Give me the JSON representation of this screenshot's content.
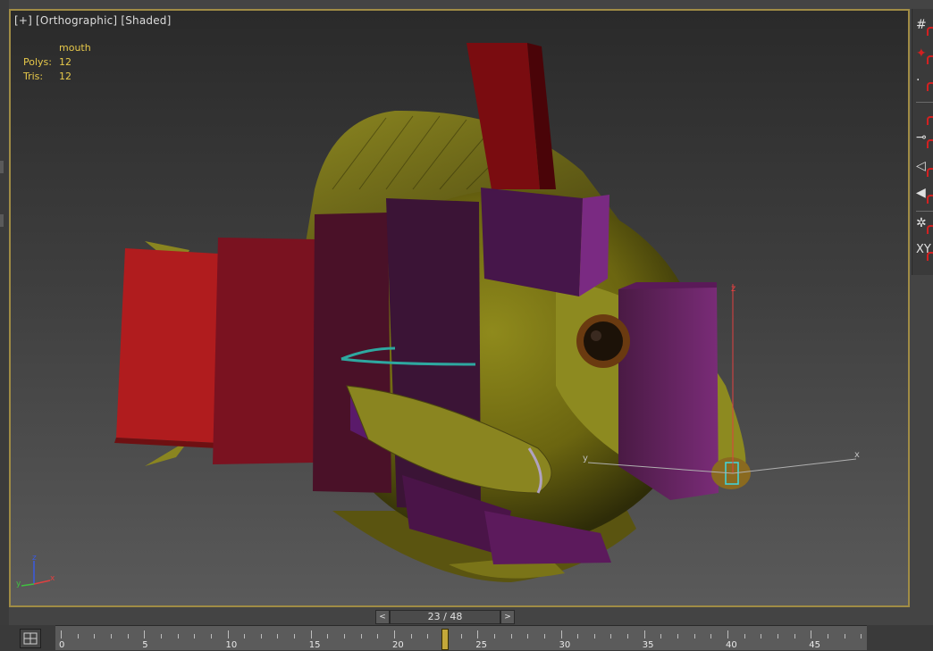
{
  "viewport": {
    "label_parts": [
      "[+]",
      "[Orthographic]",
      "[Shaded]"
    ],
    "selected_object": "mouth",
    "stats": [
      {
        "label": "Polys:",
        "value": "12"
      },
      {
        "label": "Tris:",
        "value": "12"
      }
    ],
    "border_color": "#a08c45",
    "axis_labels": {
      "x": "x",
      "y": "y",
      "z": "z"
    }
  },
  "right_toolbar": {
    "icons": [
      "grid-icon",
      "select-move-icon",
      "point-icon",
      "magnet-icon",
      "line-snap-icon",
      "angle-snap-icon",
      "filled-angle-icon",
      "spinner-snap-icon",
      "xyz-constraint-icon"
    ],
    "xyz_label": "XY"
  },
  "frame": {
    "counter": "23 / 48",
    "prev_glyph": "<",
    "next_glyph": ">",
    "current": 23,
    "total": 48
  },
  "timeline": {
    "tick_labels": [
      "0",
      "5",
      "10",
      "15",
      "20",
      "25",
      "30",
      "35",
      "40",
      "45"
    ],
    "accent": "#c4a83a"
  }
}
